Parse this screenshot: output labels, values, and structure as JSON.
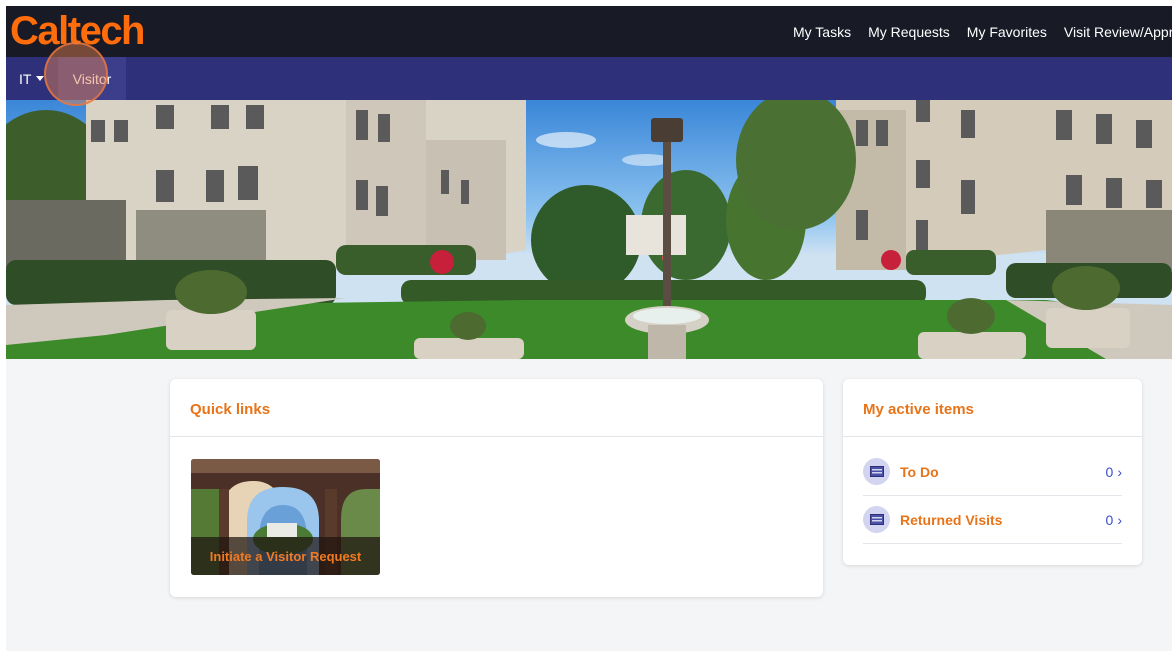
{
  "header": {
    "logo": "Caltech",
    "nav": [
      "My Tasks",
      "My Requests",
      "My Favorites",
      "Visit Review/Approv"
    ]
  },
  "subnav": {
    "menu_label": "IT",
    "active_item": "Visitor"
  },
  "quick_links": {
    "title": "Quick links",
    "tile_label": "Initiate a Visitor Request"
  },
  "active_items": {
    "title": "My active items",
    "items": [
      {
        "label": "To Do",
        "count": "0",
        "icon": "table-icon"
      },
      {
        "label": "Returned Visits",
        "count": "0",
        "icon": "table-icon"
      }
    ]
  },
  "colors": {
    "brand_orange": "#ff6c0c",
    "topbar": "#181a26",
    "subnav": "#2e307a",
    "link_blue": "#3a4ed0"
  }
}
